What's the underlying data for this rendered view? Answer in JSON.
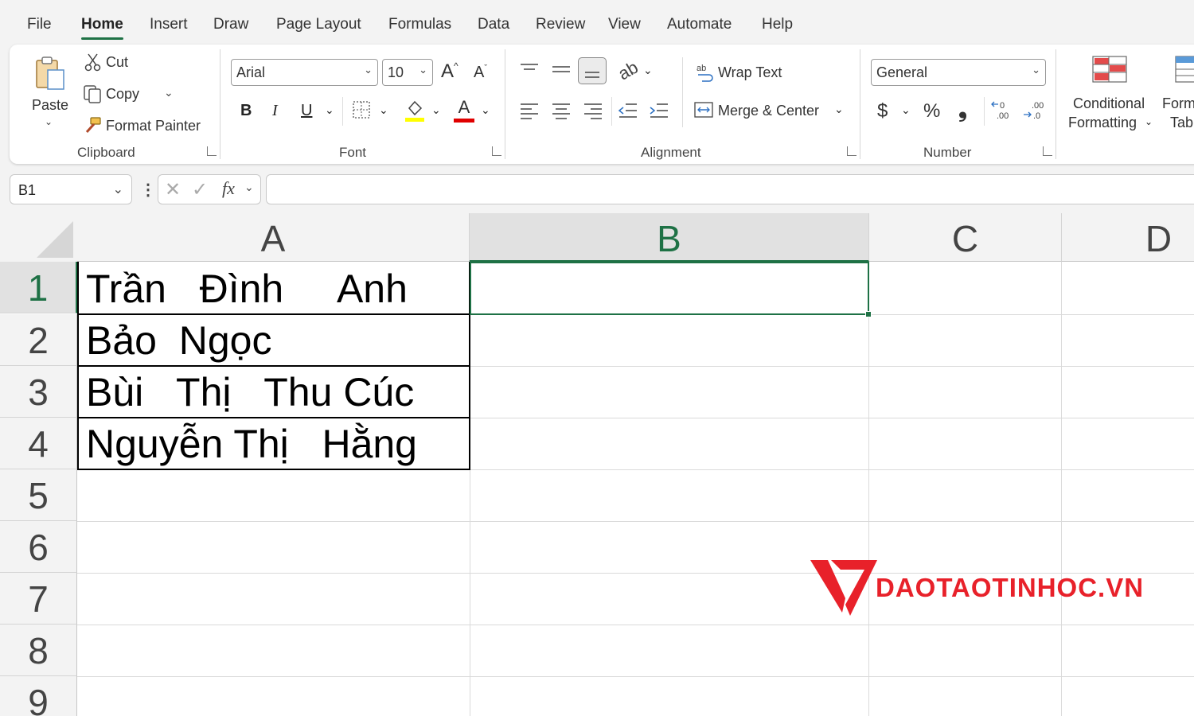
{
  "menu": {
    "tabs": [
      "File",
      "Home",
      "Insert",
      "Draw",
      "Page Layout",
      "Formulas",
      "Data",
      "Review",
      "View",
      "Automate",
      "Help"
    ],
    "active": "Home"
  },
  "clipboard": {
    "paste": "Paste",
    "cut": "Cut",
    "copy": "Copy",
    "format_painter": "Format Painter",
    "label": "Clipboard"
  },
  "font": {
    "name": "Arial",
    "size": "10",
    "grow": "A",
    "shrink": "A",
    "bold": "B",
    "italic": "I",
    "underline": "U",
    "font_color_glyph": "A",
    "highlight_color": "#ffff00",
    "font_color": "#e00000",
    "label": "Font"
  },
  "alignment": {
    "wrap_text": "Wrap Text",
    "merge_center": "Merge & Center",
    "label": "Alignment"
  },
  "number": {
    "format": "General",
    "currency": "$",
    "percent": "%",
    "comma": "❟",
    "label": "Number"
  },
  "styles": {
    "conditional_line1": "Conditional",
    "conditional_line2": "Formatting",
    "format_table_line1": "Form",
    "format_table_line2": "Tabl"
  },
  "formula_bar": {
    "name_box": "B1",
    "fx": "fx",
    "value": ""
  },
  "sheet": {
    "columns": [
      "A",
      "B",
      "C",
      "D"
    ],
    "selected_column": "B",
    "rows": [
      "1",
      "2",
      "3",
      "4",
      "5",
      "6",
      "7",
      "8",
      "9"
    ],
    "selected_row": "1",
    "cells": {
      "A1": "Trần   Đình     Anh",
      "A2": "Bảo  Ngọc",
      "A3": "Bùi   Thị   Thu Cúc",
      "A4": "Nguyễn Thị   Hằng"
    },
    "active_cell": "B1"
  },
  "watermark": {
    "text": "DAOTAOTINHOC.VN",
    "color": "#e8212a"
  },
  "accent_color": "#1e7145"
}
